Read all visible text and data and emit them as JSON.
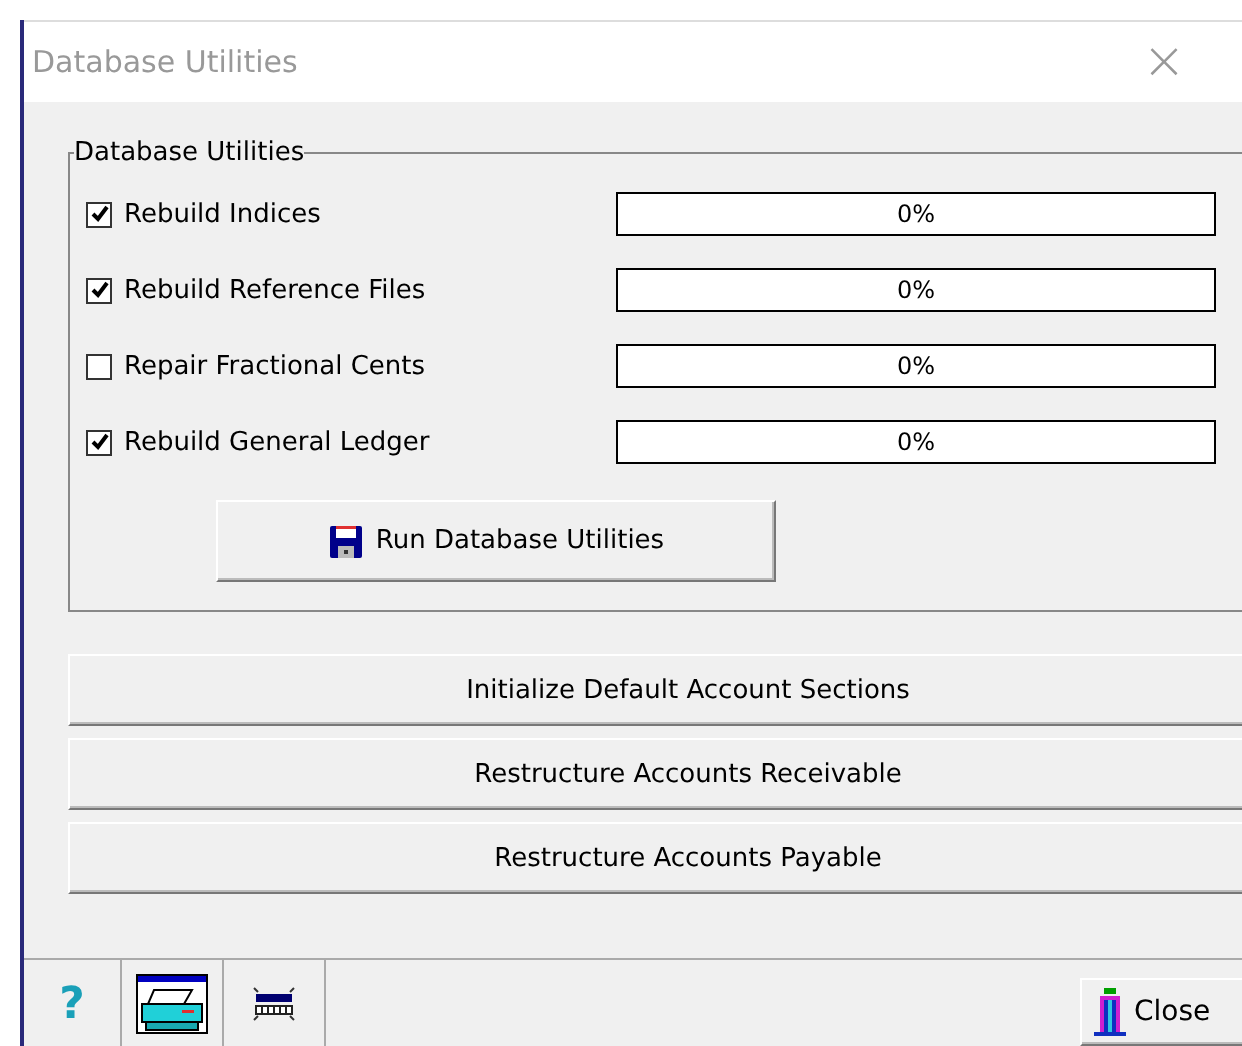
{
  "window": {
    "title": "Database Utilities",
    "close_glyph": "×"
  },
  "group": {
    "title": "Database Utilities",
    "options": [
      {
        "label": "Rebuild Indices",
        "checked": true,
        "level": 0,
        "reading": "0%"
      },
      {
        "label": "Rebuild Reference Files",
        "checked": true,
        "level": 0,
        "reading": "0%"
      },
      {
        "label": "Repair Fractional Cents",
        "checked": false,
        "level": 0,
        "reading": "0%"
      },
      {
        "label": "Rebuild General Ledger",
        "checked": true,
        "level": 0,
        "reading": "0%"
      }
    ],
    "run_button": "Run Database Utilities"
  },
  "buttons": [
    "Initialize Default Account Sections",
    "Restructure Accounts Receivable",
    "Restructure Accounts Payable"
  ],
  "toolbar": {
    "help": "?",
    "close_button": "Close"
  }
}
